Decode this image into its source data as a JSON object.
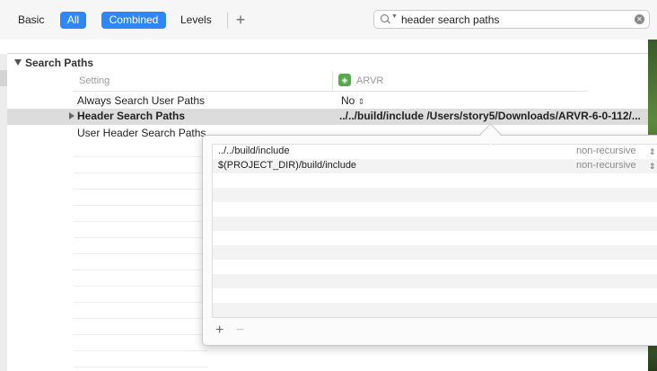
{
  "toolbar": {
    "basic": "Basic",
    "all": "All",
    "combined": "Combined",
    "levels": "Levels",
    "add": "+",
    "search_value": "header search paths"
  },
  "section": {
    "title": "Search Paths"
  },
  "columns": {
    "setting": "Setting",
    "target": "ARVR"
  },
  "settings": [
    {
      "name": "Always Search User Paths",
      "value": "No"
    },
    {
      "name": "Header Search Paths",
      "value": "../../build/include /Users/story5/Downloads/ARVR-6-0-112/..."
    },
    {
      "name": "User Header Search Paths",
      "value": ""
    }
  ],
  "popover": {
    "rows": [
      {
        "path": "../../build/include",
        "mode": "non-recursive"
      },
      {
        "path": "$(PROJECT_DIR)/build/include",
        "mode": "non-recursive"
      }
    ],
    "add": "+",
    "remove": "−"
  },
  "colors": {
    "accent": "#2f86f6",
    "target_badge": "#58a94a",
    "selected_row": "#dcdcdc"
  }
}
